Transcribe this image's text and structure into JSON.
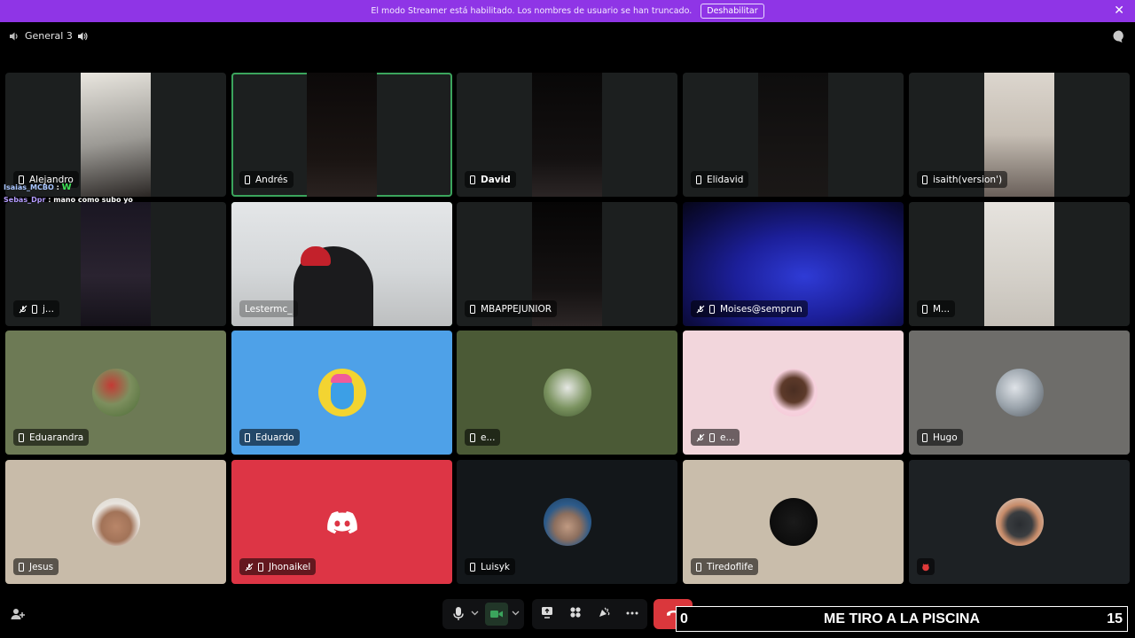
{
  "banner": {
    "message": "El modo Streamer está habilitado. Los nombres de usuario se han truncado.",
    "disable_label": "Deshabilitar",
    "color": "#8f35e6"
  },
  "channel": {
    "name": "General 3"
  },
  "overlay_chat": [
    {
      "user": "Isaias_MCBO",
      "sep": ":",
      "text": "W"
    },
    {
      "user": "Sebas_Dpr",
      "sep": ":",
      "text": "mano como subo yo"
    }
  ],
  "tiles": [
    {
      "name": "Alejandro"
    },
    {
      "name": "Andrés"
    },
    {
      "name": "David"
    },
    {
      "name": "Elidavid"
    },
    {
      "name": "isaith(version')"
    },
    {
      "name": "j..."
    },
    {
      "name": "Lestermc_"
    },
    {
      "name": "MBAPPEJUNIOR"
    },
    {
      "name": "Moises@semprun"
    },
    {
      "name": "M..."
    },
    {
      "name": "Eduarandra",
      "bg": "#6d7a55"
    },
    {
      "name": "Eduardo",
      "bg": "#4ea1e8"
    },
    {
      "name": "e...",
      "bg": "#4b5a36"
    },
    {
      "name": "e...",
      "bg": "#f2d6dc"
    },
    {
      "name": "Hugo",
      "bg": "#6e6d6a"
    },
    {
      "name": "Jesus",
      "bg": "#c8bba9"
    },
    {
      "name": "Jhonaikel",
      "bg": "#dd3545"
    },
    {
      "name": "Luisyk",
      "bg": "#13171a"
    },
    {
      "name": "Tiredoflife",
      "bg": "#c9bdab"
    },
    {
      "name": "",
      "bg": "#1d2124"
    }
  ],
  "goal_overlay": {
    "left": "0",
    "text": "ME TIRO A LA PISCINA",
    "right": "15"
  },
  "colors": {
    "speaking": "#3ba55d",
    "end_call": "#da373c"
  }
}
